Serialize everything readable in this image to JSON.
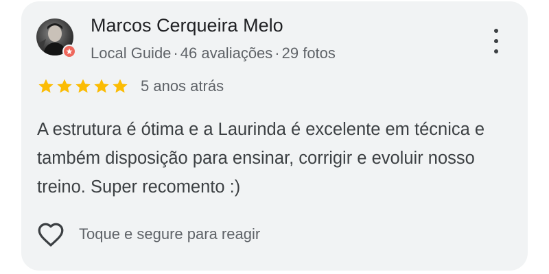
{
  "review": {
    "author_name": "Marcos Cerqueira Melo",
    "author_badge": "Local Guide",
    "review_count": "46 avaliações",
    "photo_count": "29 fotos",
    "separator": "·",
    "rating": 5,
    "rating_max": 5,
    "age": "5 anos atrás",
    "text": "A estrutura é ótima e a Laurinda é excelente em técnica e também disposição para ensinar, corrigir e evoluir nosso treino. Super recomento :)",
    "react_label": "Toque e segure para reagir"
  },
  "icons": {
    "more": "more-vert-icon",
    "heart": "heart-outline-icon",
    "star": "star-icon",
    "badge": "local-guide-badge-icon"
  },
  "colors": {
    "card_background": "#f1f3f4",
    "star": "#fbbc04",
    "local_guide_badge": "#ee675c",
    "secondary_text": "#5f6368"
  }
}
